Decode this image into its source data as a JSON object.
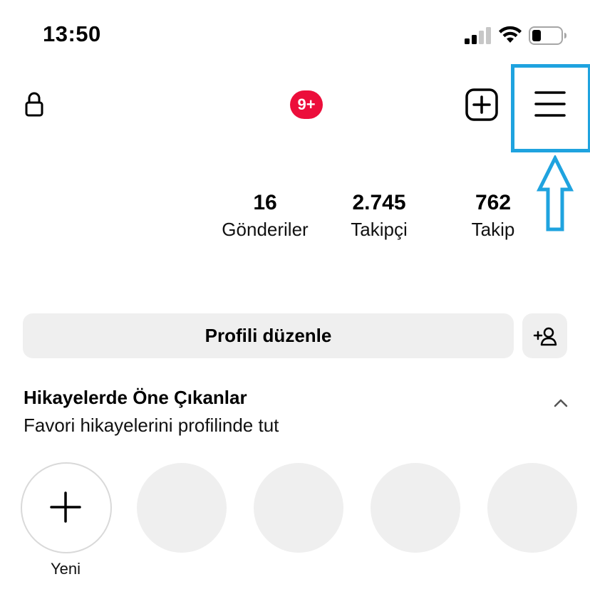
{
  "status_bar": {
    "time": "13:50",
    "icons": [
      "signal-icon",
      "wifi-icon",
      "battery-icon"
    ]
  },
  "nav": {
    "left_icon": "lock-icon",
    "notification_badge": "9+",
    "right_icons": [
      "create-icon",
      "menu-icon"
    ]
  },
  "stats": [
    {
      "value": "16",
      "label": "Gönderiler"
    },
    {
      "value": "2.745",
      "label": "Takipçi"
    },
    {
      "value": "762",
      "label": "Takip"
    }
  ],
  "actions": {
    "edit_profile": "Profili düzenle",
    "discover_people_icon": "add-person-icon"
  },
  "highlights": {
    "title": "Hikayelerde Öne Çıkanlar",
    "subtitle": "Favori hikayelerini profilinde tut",
    "new_label": "Yeni",
    "placeholder_count": 4
  },
  "annotation": {
    "color": "#1fa3df",
    "shapes": [
      "highlight-box",
      "up-arrow"
    ]
  },
  "colors": {
    "badge": "#ec0e3b",
    "button_bg": "#efefef",
    "annotation": "#1fa3df"
  }
}
